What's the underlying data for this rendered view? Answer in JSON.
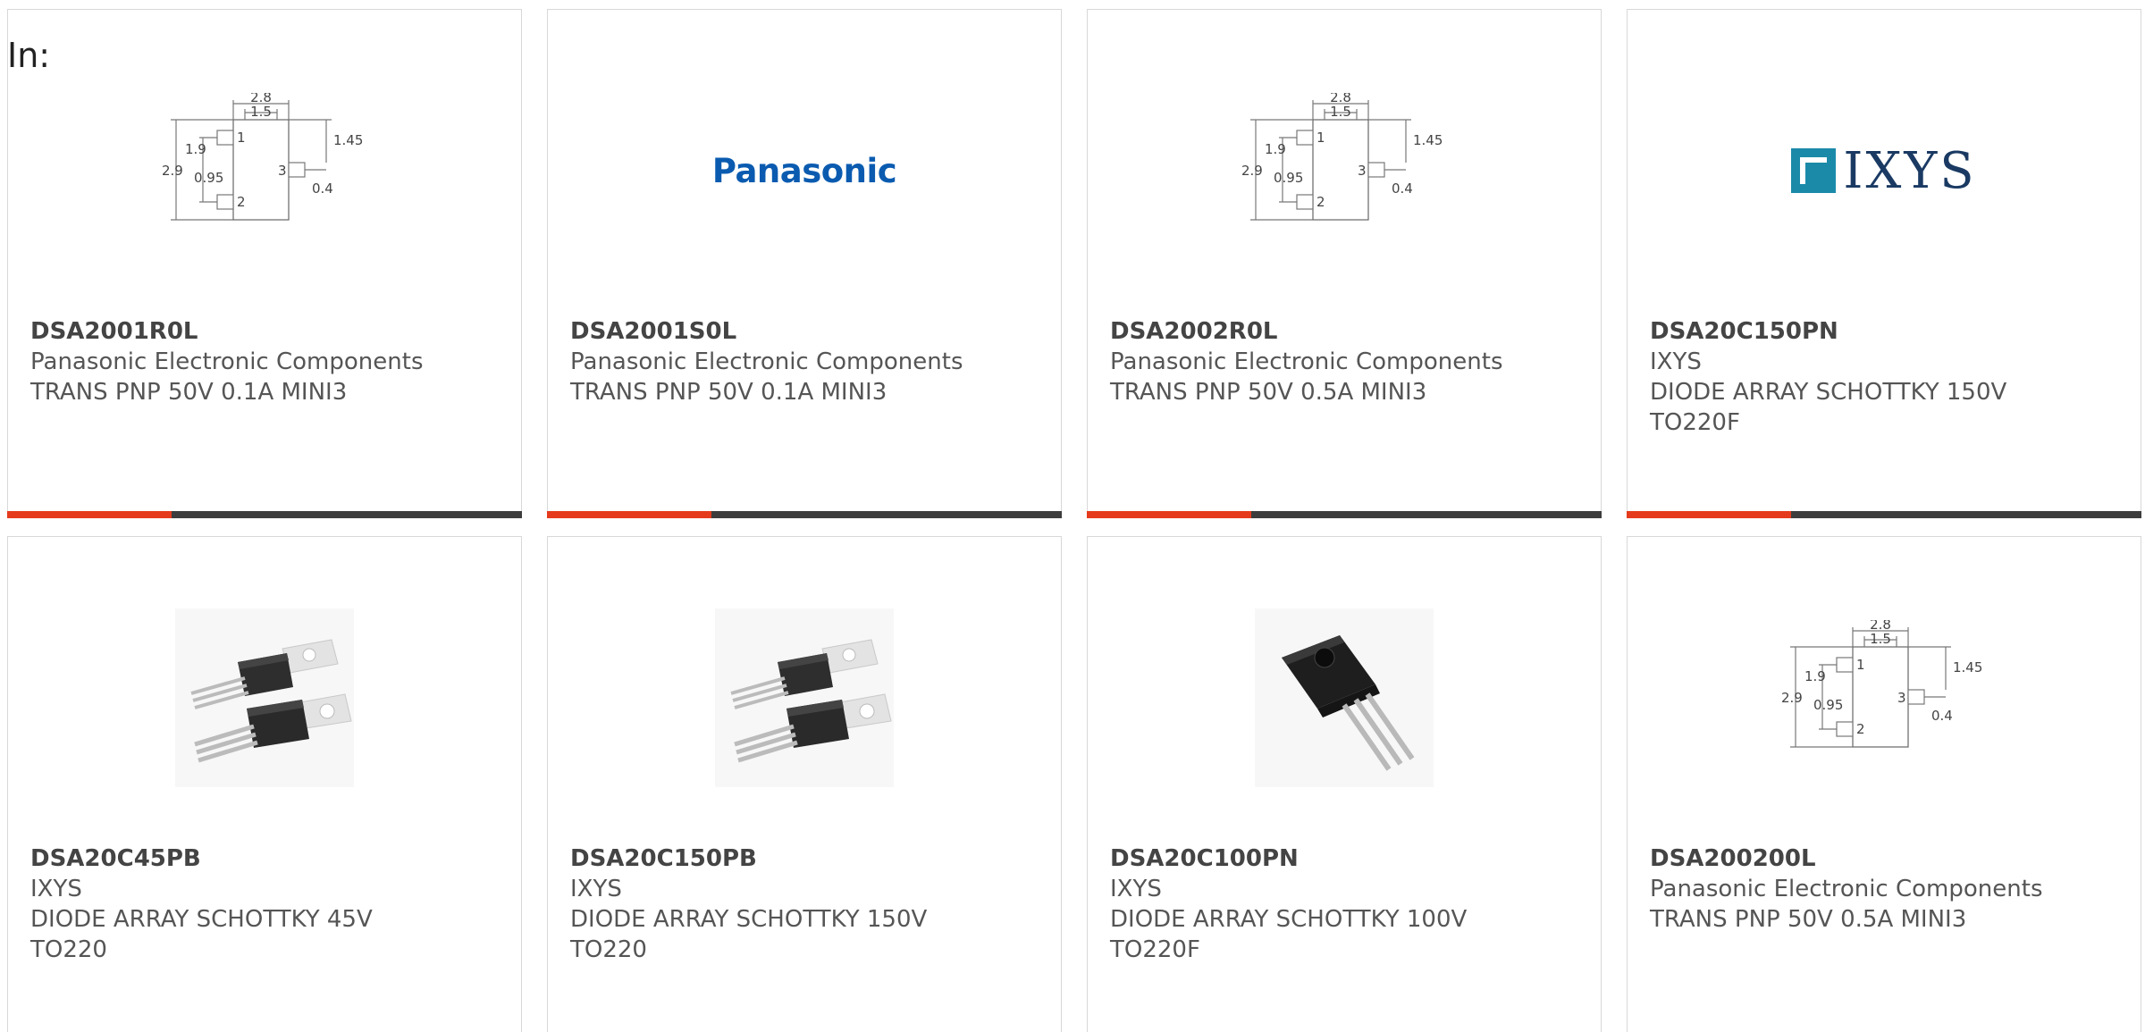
{
  "filter": {
    "in_label": "In:"
  },
  "colors": {
    "accent": "#e53b1c",
    "bar": "#3d3d3d",
    "panasonic_blue": "#0a5bb0",
    "ixys_navy": "#1a3a63",
    "ixys_teal": "#1b8aa9"
  },
  "cards": [
    {
      "part_number": "DSA2001R0L",
      "manufacturer": "Panasonic Electronic Components",
      "desc1": "TRANS PNP 50V 0.1A MINI3",
      "desc2": "",
      "image": "mini3-package-drawing"
    },
    {
      "part_number": "DSA2001S0L",
      "manufacturer": "Panasonic Electronic Components",
      "desc1": "TRANS PNP 50V 0.1A MINI3",
      "desc2": "",
      "image": "panasonic-logo",
      "logo_text": "Panasonic"
    },
    {
      "part_number": "DSA2002R0L",
      "manufacturer": "Panasonic Electronic Components",
      "desc1": "TRANS PNP 50V 0.5A MINI3",
      "desc2": "",
      "image": "mini3-package-drawing"
    },
    {
      "part_number": "DSA20C150PN",
      "manufacturer": "IXYS",
      "desc1": "DIODE ARRAY SCHOTTKY 150V",
      "desc2": "TO220F",
      "image": "ixys-logo",
      "logo_text": "IXYS"
    },
    {
      "part_number": "DSA20C45PB",
      "manufacturer": "IXYS",
      "desc1": "DIODE ARRAY SCHOTTKY 45V",
      "desc2": "TO220",
      "image": "to220-photo"
    },
    {
      "part_number": "DSA20C150PB",
      "manufacturer": "IXYS",
      "desc1": "DIODE ARRAY SCHOTTKY 150V",
      "desc2": "TO220",
      "image": "to220-photo"
    },
    {
      "part_number": "DSA20C100PN",
      "manufacturer": "IXYS",
      "desc1": "DIODE ARRAY SCHOTTKY 100V",
      "desc2": "TO220F",
      "image": "to220f-photo"
    },
    {
      "part_number": "DSA200200L",
      "manufacturer": "Panasonic Electronic Components",
      "desc1": "TRANS PNP 50V 0.5A MINI3",
      "desc2": "",
      "image": "mini3-package-drawing"
    }
  ],
  "mini3_drawing": {
    "dim_top_outer": "2.8",
    "dim_top_inner": "1.5",
    "dim_left_pitch": "1.9",
    "dim_height": "2.9",
    "dim_pad": "0.95",
    "dim_right": "1.45",
    "dim_lead": "0.4",
    "pin1": "1",
    "pin2": "2",
    "pin3": "3"
  }
}
